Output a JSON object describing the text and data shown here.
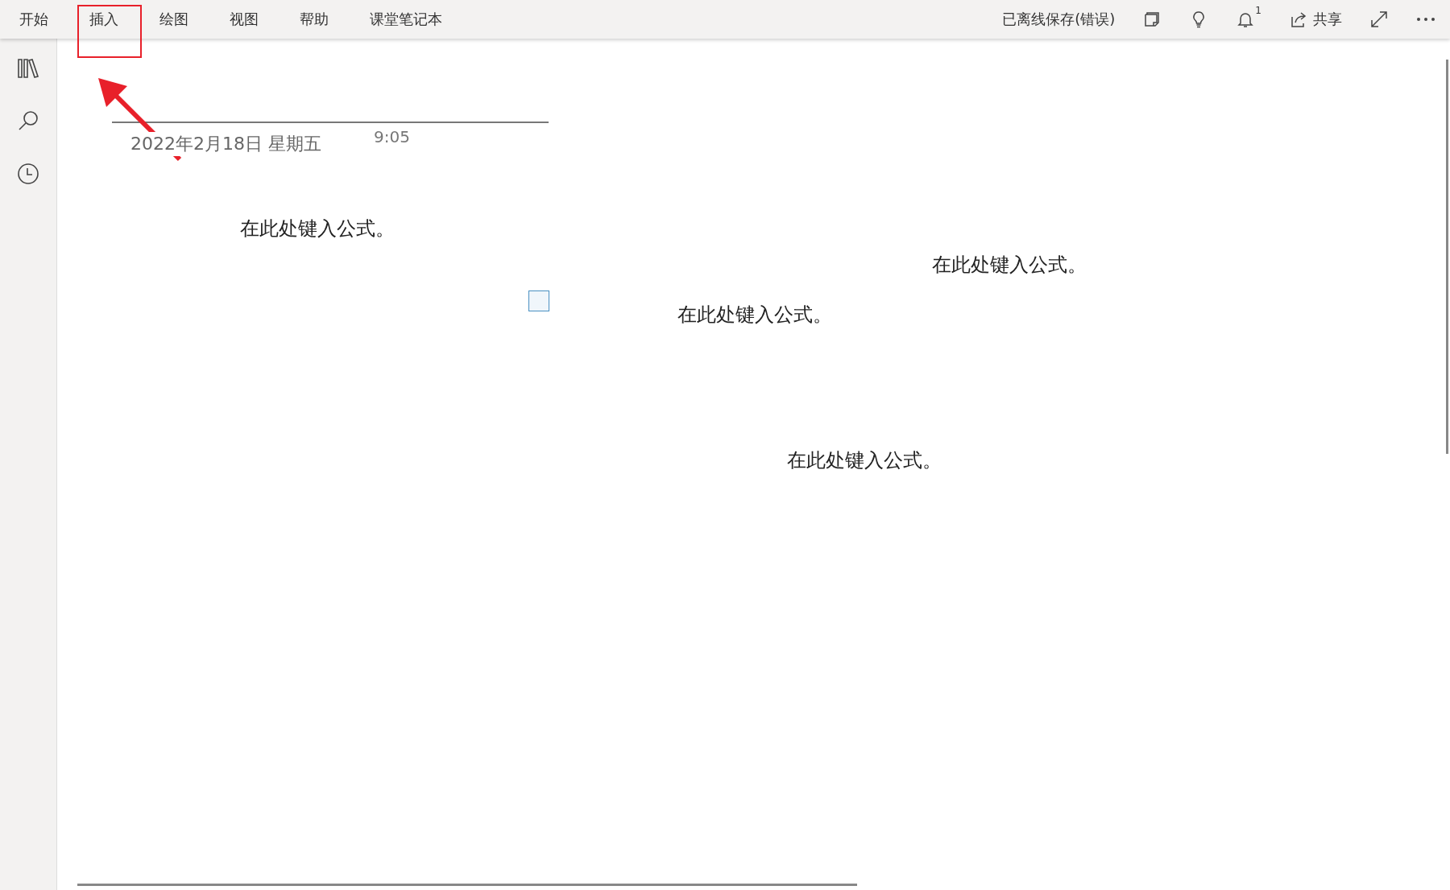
{
  "ribbon_tabs": [
    {
      "label": "开始"
    },
    {
      "label": "插入"
    },
    {
      "label": "绘图"
    },
    {
      "label": "视图"
    },
    {
      "label": "帮助"
    },
    {
      "label": "课堂笔记本"
    }
  ],
  "status": "已离线保存(错误)",
  "notifications": {
    "count": "1"
  },
  "share": {
    "label": "共享"
  },
  "page": {
    "date": "2022年2月18日 星期五",
    "time": "9:05"
  },
  "equations": [
    {
      "text": "在此处键入公式。"
    },
    {
      "text": "在此处键入公式。"
    },
    {
      "text": "在此处键入公式。"
    },
    {
      "text": "在此处键入公式。"
    }
  ]
}
